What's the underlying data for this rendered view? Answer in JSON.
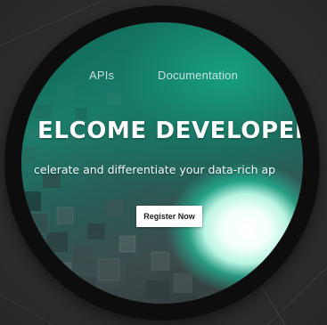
{
  "nav": {
    "apis_label": "APIs",
    "docs_label": "Documentation"
  },
  "hero": {
    "title": "ELCOME DEVELOPEI",
    "subtitle": "celerate and differentiate your data-rich ap",
    "cta_label": "Register Now"
  },
  "colors": {
    "background": "#2e2e2e",
    "bezel": "#0d0d0d",
    "accent_teal": "#1a7d6a",
    "glow": "#ffffff"
  }
}
